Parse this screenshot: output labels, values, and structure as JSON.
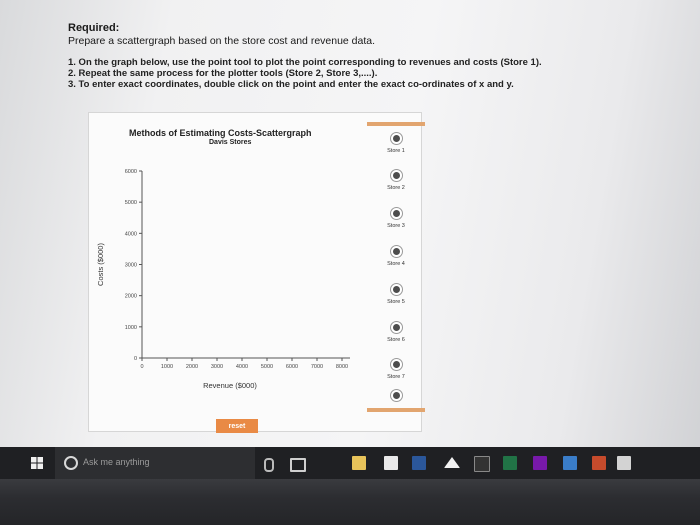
{
  "question": {
    "title": "Required:",
    "description": "Prepare a scattergraph based on the store cost and revenue data.",
    "instructions": [
      "1. On the graph below, use the point tool to plot the point corresponding to revenues and costs (Store 1).",
      "2. Repeat the same process for the plotter tools (Store 2, Store 3,....).",
      "3. To enter exact coordinates, double click on the point and enter the exact co-ordinates of x and y."
    ]
  },
  "chart": {
    "title": "Methods of Estimating Costs-Scattergraph",
    "subtitle": "Davis Stores",
    "x_label": "Revenue ($000)",
    "y_label": "Costs ($000)",
    "reset_label": "reset"
  },
  "chart_data": {
    "type": "scatter",
    "title": "Methods of Estimating Costs-Scattergraph",
    "subtitle": "Davis Stores",
    "xlabel": "Revenue ($000)",
    "ylabel": "Costs ($000)",
    "xlim": [
      0,
      8000
    ],
    "ylim": [
      0,
      6000
    ],
    "x_ticks": [
      "0",
      "1000",
      "2000",
      "3000",
      "4000",
      "5000",
      "6000",
      "7000",
      "8000"
    ],
    "y_ticks": [
      "0",
      "1000",
      "2000",
      "3000",
      "4000",
      "5000",
      "6000"
    ],
    "x_tick_values": [
      0,
      1000,
      2000,
      3000,
      4000,
      5000,
      6000,
      7000,
      8000
    ],
    "y_tick_values": [
      0,
      1000,
      2000,
      3000,
      4000,
      5000,
      6000
    ],
    "grid": false,
    "series": []
  },
  "tools": [
    {
      "label": "Store 1"
    },
    {
      "label": "Store 2"
    },
    {
      "label": "Store 3"
    },
    {
      "label": "Store 4"
    },
    {
      "label": "Store 5"
    },
    {
      "label": "Store 6"
    },
    {
      "label": "Store 7"
    },
    {
      "label": ""
    }
  ],
  "taskbar": {
    "search_placeholder": "Ask me anything",
    "icons": [
      "start-icon",
      "microphone-icon",
      "task-view-icon",
      "file-explorer-icon",
      "store-icon",
      "word-icon",
      "home-icon",
      "amazon-icon",
      "excel-icon",
      "onenote-icon",
      "app-icon",
      "app-icon",
      "chat-icon"
    ]
  },
  "colors": {
    "accent": "#e98a45",
    "marker": "#4d4d4d",
    "taskbar": "#1f2023"
  }
}
